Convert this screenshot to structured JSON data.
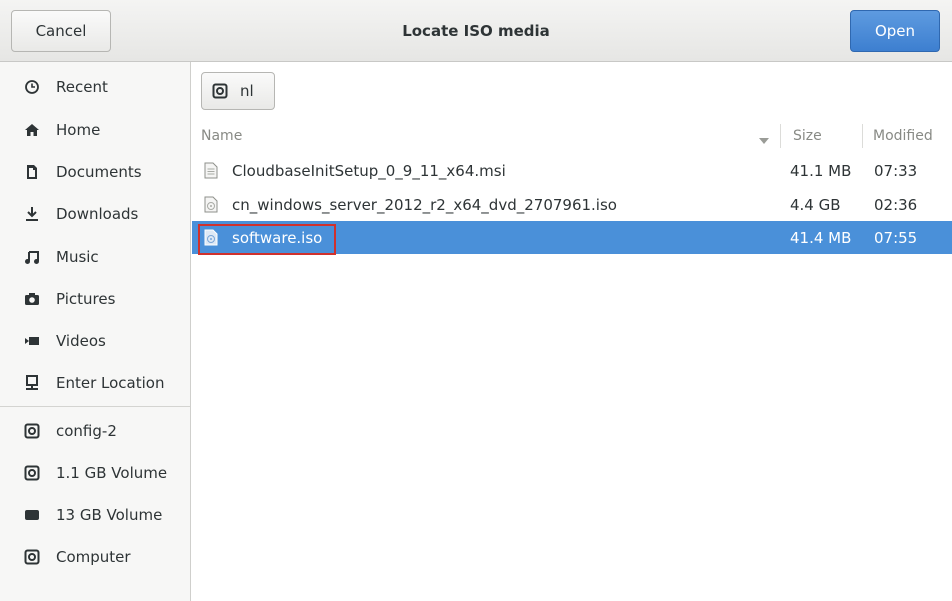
{
  "header": {
    "cancel_label": "Cancel",
    "title": "Locate ISO media",
    "open_label": "Open"
  },
  "sidebar": {
    "items": [
      {
        "label": "Recent",
        "icon": "clock-icon"
      },
      {
        "label": "Home",
        "icon": "home-icon"
      },
      {
        "label": "Documents",
        "icon": "document-icon"
      },
      {
        "label": "Downloads",
        "icon": "download-icon"
      },
      {
        "label": "Music",
        "icon": "music-icon"
      },
      {
        "label": "Pictures",
        "icon": "camera-icon"
      },
      {
        "label": "Videos",
        "icon": "video-icon"
      },
      {
        "label": "Enter Location",
        "icon": "location-icon"
      }
    ],
    "devices": [
      {
        "label": "config-2",
        "icon": "drive-icon"
      },
      {
        "label": "1.1 GB Volume",
        "icon": "drive-icon"
      },
      {
        "label": "13 GB Volume",
        "icon": "harddisk-icon"
      },
      {
        "label": "Computer",
        "icon": "drive-icon"
      }
    ]
  },
  "pathbar": {
    "label": "nl"
  },
  "columns": {
    "name": "Name",
    "size": "Size",
    "modified": "Modified"
  },
  "files": [
    {
      "name": "CloudbaseInitSetup_0_9_11_x64.msi",
      "size": "41.1 MB",
      "modified": "07:33",
      "selected": false
    },
    {
      "name": "cn_windows_server_2012_r2_x64_dvd_2707961.iso",
      "size": "4.4 GB",
      "modified": "02:36",
      "selected": false
    },
    {
      "name": "software.iso",
      "size": "41.4 MB",
      "modified": "07:55",
      "selected": true
    }
  ],
  "colors": {
    "accent": "#4a90d9",
    "highlight_box": "#d0312d"
  }
}
